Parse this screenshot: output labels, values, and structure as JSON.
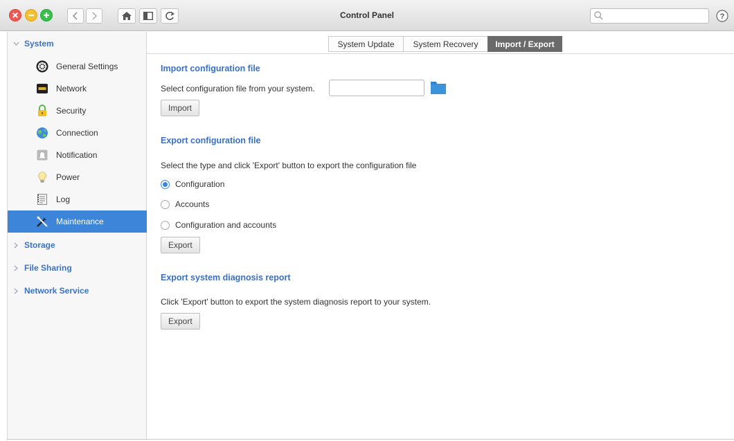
{
  "window": {
    "title": "Control Panel",
    "search_placeholder": ""
  },
  "sidebar": {
    "sections": [
      {
        "label": "System",
        "expanded": true
      },
      {
        "label": "Storage",
        "expanded": false
      },
      {
        "label": "File Sharing",
        "expanded": false
      },
      {
        "label": "Network Service",
        "expanded": false
      }
    ],
    "items": [
      {
        "label": "General Settings",
        "icon": "gear-icon"
      },
      {
        "label": "Network",
        "icon": "network-icon"
      },
      {
        "label": "Security",
        "icon": "lock-icon"
      },
      {
        "label": "Connection",
        "icon": "globe-icon"
      },
      {
        "label": "Notification",
        "icon": "bell-icon"
      },
      {
        "label": "Power",
        "icon": "lightbulb-icon"
      },
      {
        "label": "Log",
        "icon": "log-icon"
      },
      {
        "label": "Maintenance",
        "icon": "tools-icon",
        "selected": true
      }
    ]
  },
  "tabs": [
    {
      "label": "System Update"
    },
    {
      "label": "System Recovery"
    },
    {
      "label": "Import / Export",
      "active": true
    }
  ],
  "import": {
    "heading": "Import configuration file",
    "description": "Select configuration file from your system.",
    "file_value": "",
    "button": "Import"
  },
  "export": {
    "heading": "Export configuration file",
    "description": "Select the type and click 'Export' button to export the configuration file",
    "options": [
      {
        "label": "Configuration",
        "checked": true
      },
      {
        "label": "Accounts",
        "checked": false
      },
      {
        "label": "Configuration and accounts",
        "checked": false
      }
    ],
    "button": "Export"
  },
  "diagnosis": {
    "heading": "Export system diagnosis report",
    "description": "Click 'Export' button to export the system diagnosis report to your system.",
    "button": "Export"
  },
  "colors": {
    "accent": "#3d85d8",
    "heading": "#3a6fc2",
    "active_tab": "#6a6a6a",
    "close": "#ee5a53",
    "minimize": "#f5c030",
    "maximize": "#38c14a"
  }
}
